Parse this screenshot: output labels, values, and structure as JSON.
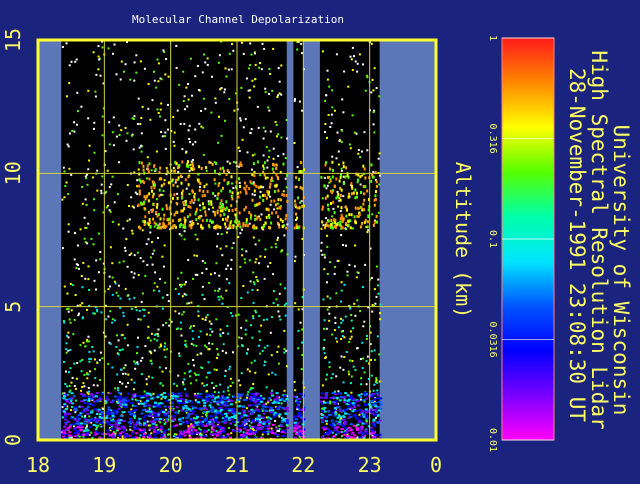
{
  "colors": {
    "background": "#1a237e",
    "frame": "#ffff33",
    "grid": "#d4d43a",
    "no_data": "#5b77b8",
    "text": "#ffff66",
    "title_text": "#ffffff",
    "particles": "#ffffff"
  },
  "chart_data": {
    "type": "heatmap",
    "title": "Molecular Channel Depolarization",
    "ylabel": "Altitude (km)",
    "xlabel": "",
    "xlim": [
      18,
      24
    ],
    "ylim": [
      0,
      15
    ],
    "x_ticks": [
      18,
      19,
      20,
      21,
      22,
      23,
      0
    ],
    "y_ticks": [
      0,
      5,
      10,
      15
    ],
    "grid": true,
    "colorbar": {
      "scale": "log",
      "range": [
        0.01,
        1
      ],
      "ticks": [
        1,
        0.316,
        0.1,
        0.0316,
        0.01
      ],
      "tick_labels": [
        "1",
        "0.316",
        "0.1",
        "0.0316",
        "0.01"
      ],
      "colors_top_to_bottom": [
        "#ff1a1a",
        "#ff8800",
        "#ffff00",
        "#55ff00",
        "#00ffaa",
        "#00e5ff",
        "#0055ff",
        "#0000ff",
        "#7a00ff",
        "#ff00ff"
      ]
    },
    "no_data_intervals": [
      [
        18,
        18.35
      ],
      [
        21.75,
        21.85
      ],
      [
        22.0,
        22.25
      ],
      [
        23.15,
        24
      ]
    ],
    "layers": [
      {
        "name": "cirrus",
        "x_range": [
          19.5,
          23.1
        ],
        "altitude_km": [
          8.0,
          10.5
        ]
      },
      {
        "name": "boundary layer",
        "x_range": [
          18.35,
          23.15
        ],
        "altitude_km": [
          0,
          1.8
        ]
      }
    ]
  },
  "side_text": {
    "line1": "University of Wisconsin",
    "line2": "High Spectral Resolution Lidar",
    "line3": "28-November-1991 23:08:30 UT"
  }
}
